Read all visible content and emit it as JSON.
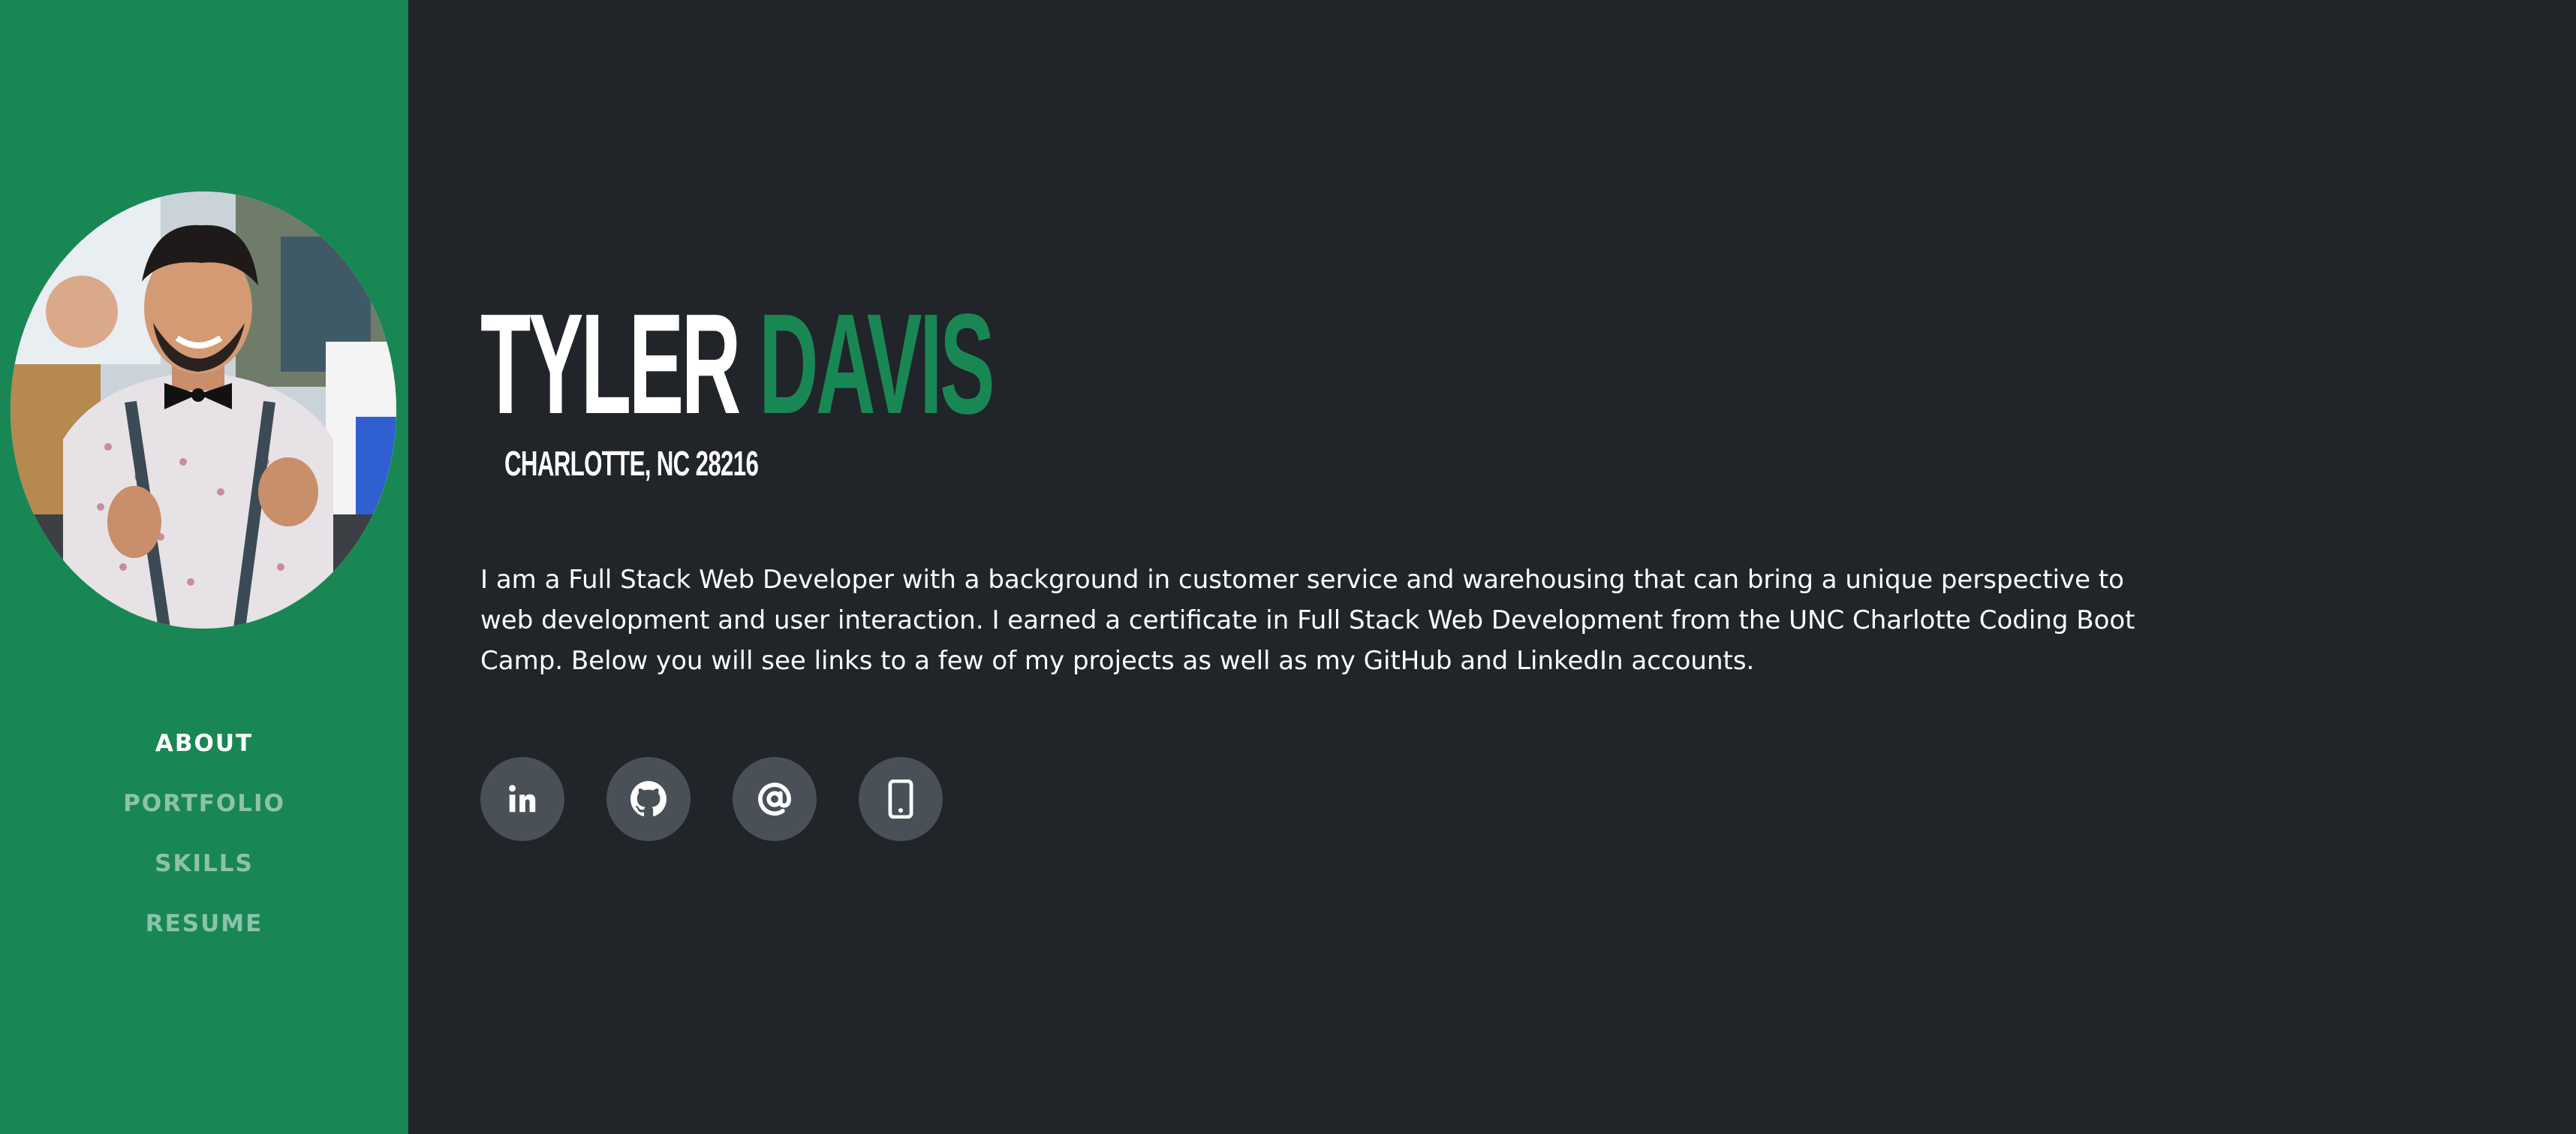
{
  "sidebar": {
    "avatar_alt": "profile photo",
    "nav": [
      {
        "label": "ABOUT",
        "active": true
      },
      {
        "label": "PORTFOLIO",
        "active": false
      },
      {
        "label": "SKILLS",
        "active": false
      },
      {
        "label": "RESUME",
        "active": false
      }
    ]
  },
  "header": {
    "first_name": "TYLER",
    "last_name": "DAVIS",
    "address": "CHARLOTTE, NC 28216"
  },
  "about": {
    "bio": "I am a Full Stack Web Developer with a background in customer service and warehousing that can bring a unique perspective to web development and user interaction. I earned a certificate in Full Stack Web Development from the UNC Charlotte Coding Boot Camp. Below you will see links to a few of my projects as well as my GitHub and LinkedIn accounts."
  },
  "social": [
    {
      "icon": "linkedin-icon"
    },
    {
      "icon": "github-icon"
    },
    {
      "icon": "email-at-icon"
    },
    {
      "icon": "mobile-phone-icon"
    }
  ],
  "colors": {
    "brand_green": "#198754",
    "background": "#212429",
    "social_button": "#495057"
  }
}
